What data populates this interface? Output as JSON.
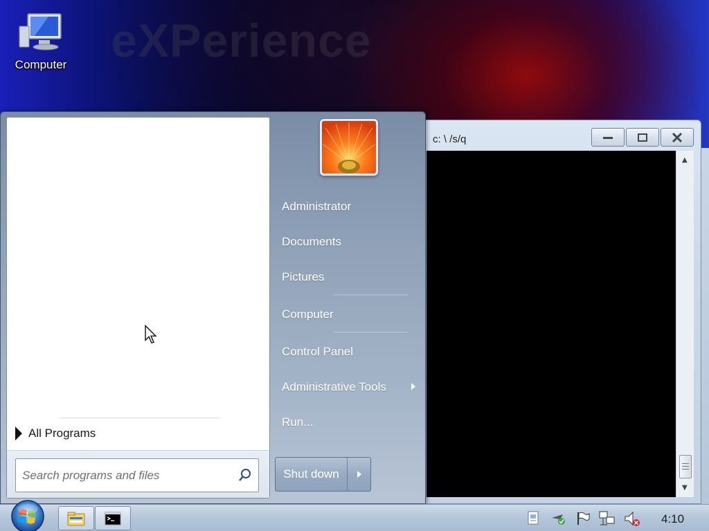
{
  "desktop": {
    "wallpaper_text": "eXPerience",
    "icons": [
      {
        "label": "Computer",
        "icon": "computer-icon"
      }
    ]
  },
  "console_window": {
    "title": "c: \\ /s/q",
    "buttons": [
      "minimize",
      "maximize",
      "close"
    ]
  },
  "start_menu": {
    "all_programs_label": "All Programs",
    "search_placeholder": "Search programs and files",
    "user_picture": "flower-user-picture",
    "right_items": [
      "Administrator",
      "Documents",
      "Pictures",
      "Computer",
      "Control Panel",
      "Administrative Tools",
      "Run..."
    ],
    "shutdown_label": "Shut down"
  },
  "taskbar": {
    "start_orb": "windows-orb-icon",
    "pinned": [
      "file-explorer-icon",
      "command-prompt-icon"
    ],
    "tray_icons": [
      "notification-icon",
      "network-check-icon",
      "action-center-flag-icon",
      "network-icon",
      "volume-muted-icon"
    ],
    "clock": "4:10"
  },
  "colors": {
    "menu_right_pane": "#8d9fb6",
    "taskbar": "#b6c7db",
    "console_screen": "#000000"
  }
}
